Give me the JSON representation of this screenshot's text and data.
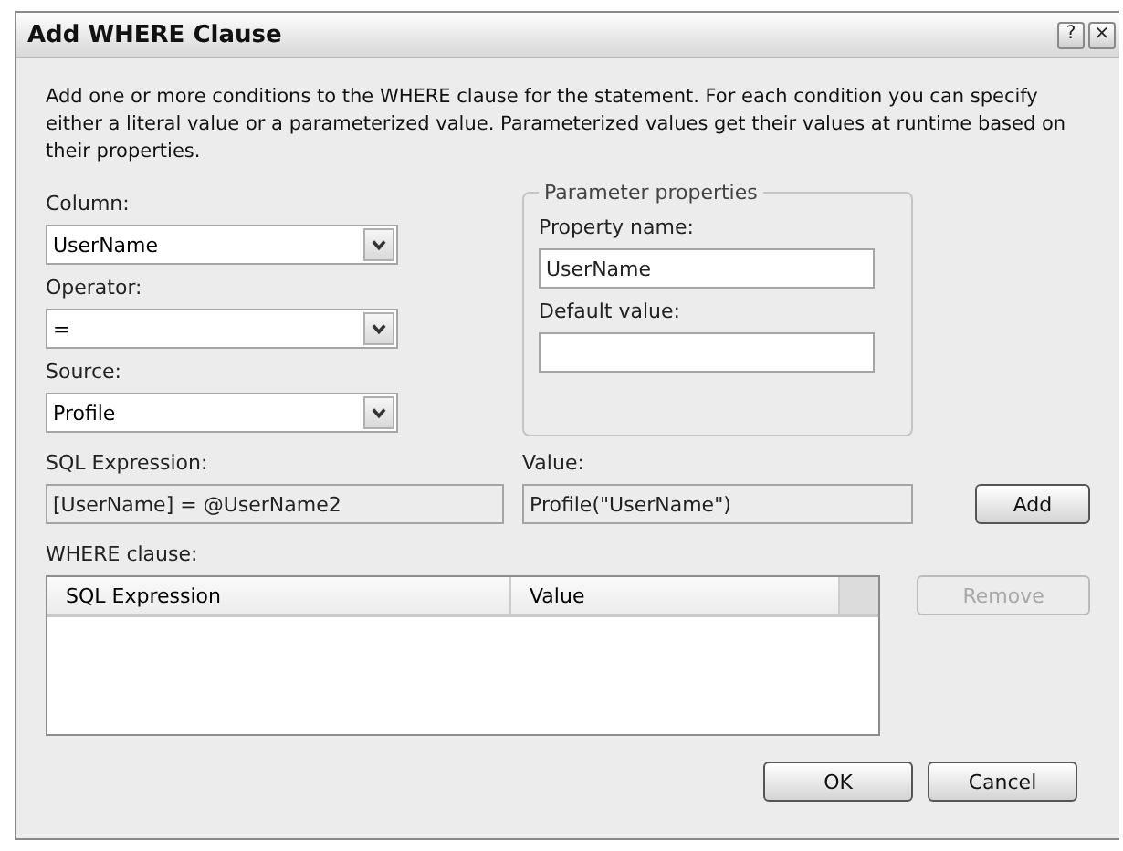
{
  "window": {
    "title": "Add WHERE Clause",
    "buttons": [
      "?",
      "×"
    ]
  },
  "description": "Add one or more conditions to the WHERE clause for the statement. For each condition you can specify either a literal value or a parameterized value. Parameterized values get their values at runtime based on their properties.",
  "column": {
    "label": "Column:",
    "value": "UserName"
  },
  "operator": {
    "label": "Operator:",
    "value": "="
  },
  "source": {
    "label": "Source:",
    "value": "Profile"
  },
  "parameter_properties": {
    "title": "Parameter properties",
    "property_name": {
      "label": "Property name:",
      "value": "UserName"
    },
    "default_value": {
      "label": "Default value:"
    }
  },
  "sql_expression": {
    "label": "SQL Expression:",
    "value": "[UserName] = @UserName2"
  },
  "value": {
    "label": "Value:",
    "value": "Profile(\"UserName\")"
  },
  "add_button": {
    "label": "Add",
    "disabled": false
  },
  "where_clause": {
    "label": "WHERE clause:",
    "columns": [
      "SQL Expression",
      "Value"
    ]
  },
  "remove_button": {
    "label": "Remove",
    "disabled": true
  },
  "buttons": [
    "OK",
    "Cancel"
  ]
}
